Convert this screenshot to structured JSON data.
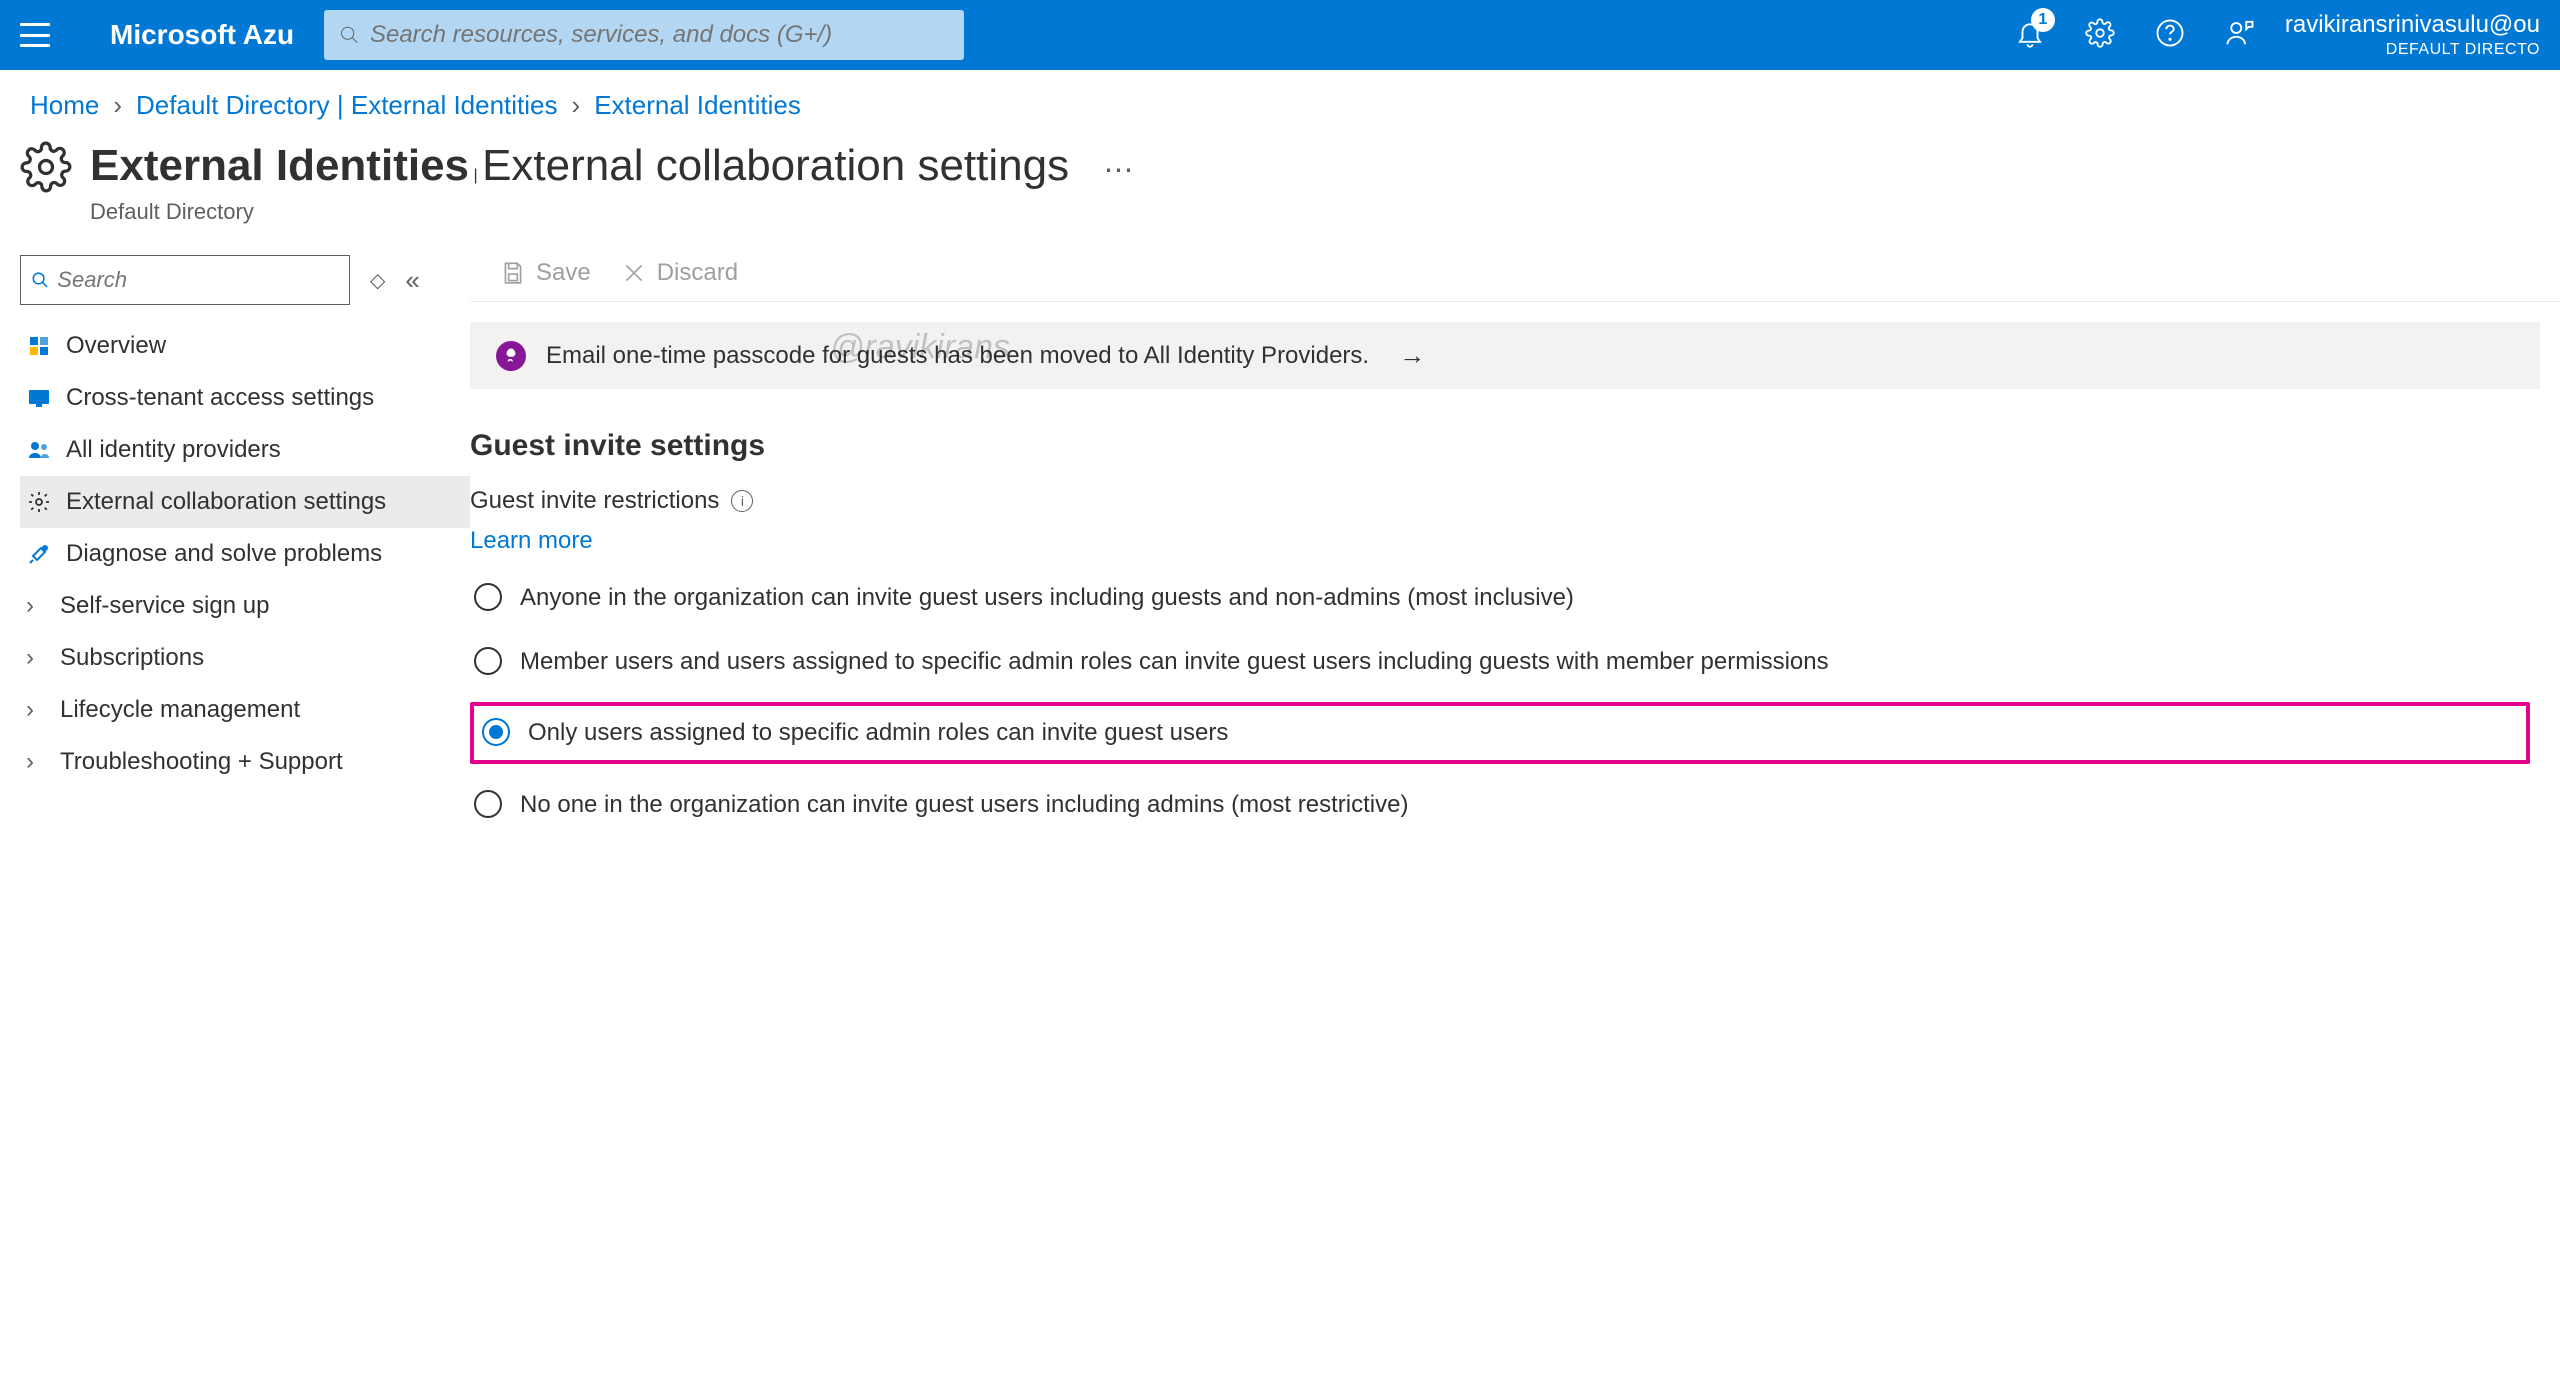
{
  "header": {
    "brand": "Microsoft Azu",
    "search_placeholder": "Search resources, services, and docs (G+/)",
    "notification_count": "1",
    "user_email": "ravikiransrinivasulu@ou",
    "user_directory": "DEFAULT DIRECTO"
  },
  "breadcrumb": {
    "items": [
      "Home",
      "Default Directory | External Identities",
      "External Identities"
    ]
  },
  "title": {
    "main": "External Identities",
    "sub": "External collaboration settings",
    "subtitle": "Default Directory"
  },
  "sidebar_search_placeholder": "Search",
  "sidebar": {
    "items": [
      {
        "label": "Overview"
      },
      {
        "label": "Cross-tenant access settings"
      },
      {
        "label": "All identity providers"
      },
      {
        "label": "External collaboration settings"
      },
      {
        "label": "Diagnose and solve problems"
      },
      {
        "label": "Self-service sign up"
      },
      {
        "label": "Subscriptions"
      },
      {
        "label": "Lifecycle management"
      },
      {
        "label": "Troubleshooting + Support"
      }
    ]
  },
  "toolbar": {
    "save_label": "Save",
    "discard_label": "Discard"
  },
  "info_bar": {
    "text": "Email one-time passcode for guests has been moved to All Identity Providers."
  },
  "section": {
    "heading": "Guest invite settings",
    "field_label": "Guest invite restrictions",
    "learn_more": "Learn more",
    "options": [
      "Anyone in the organization can invite guest users including guests and non-admins (most inclusive)",
      "Member users and users assigned to specific admin roles can invite guest users including guests with member permissions",
      "Only users assigned to specific admin roles can invite guest users",
      "No one in the organization can invite guest users including admins (most restrictive)"
    ]
  },
  "watermark": "@ravikirans"
}
